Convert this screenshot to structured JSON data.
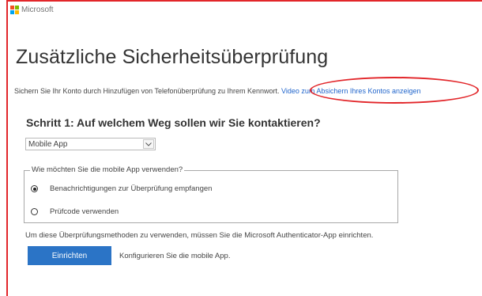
{
  "brand": {
    "name": "Microsoft",
    "logo_colors": [
      "#f25022",
      "#7fba00",
      "#00a4ef",
      "#ffb900"
    ]
  },
  "page": {
    "title": "Zusätzliche Sicherheitsüberprüfung",
    "intro_text": "Sichern Sie Ihr Konto durch Hinzufügen von Telefonüberprüfung zu Ihrem Kennwort. ",
    "intro_link": "Video zum Absichern Ihres Kontos anzeigen"
  },
  "step1": {
    "heading": "Schritt 1: Auf welchem Weg sollen wir Sie kontaktieren?",
    "method_select": {
      "value": "Mobile App"
    },
    "app_usage": {
      "legend": "Wie möchten Sie die mobile App verwenden?",
      "options": [
        {
          "label": "Benachrichtigungen zur Überprüfung empfangen",
          "selected": true
        },
        {
          "label": "Prüfcode verwenden",
          "selected": false
        }
      ]
    },
    "setup_info": "Um diese Überprüfungsmethoden zu verwenden, müssen Sie die Microsoft Authenticator-App einrichten.",
    "setup_button": "Einrichten",
    "setup_hint": "Konfigurieren Sie die mobile App."
  },
  "colors": {
    "accent": "#2b74c6",
    "link": "#2266cc",
    "annotation_red": "#e2262a"
  }
}
